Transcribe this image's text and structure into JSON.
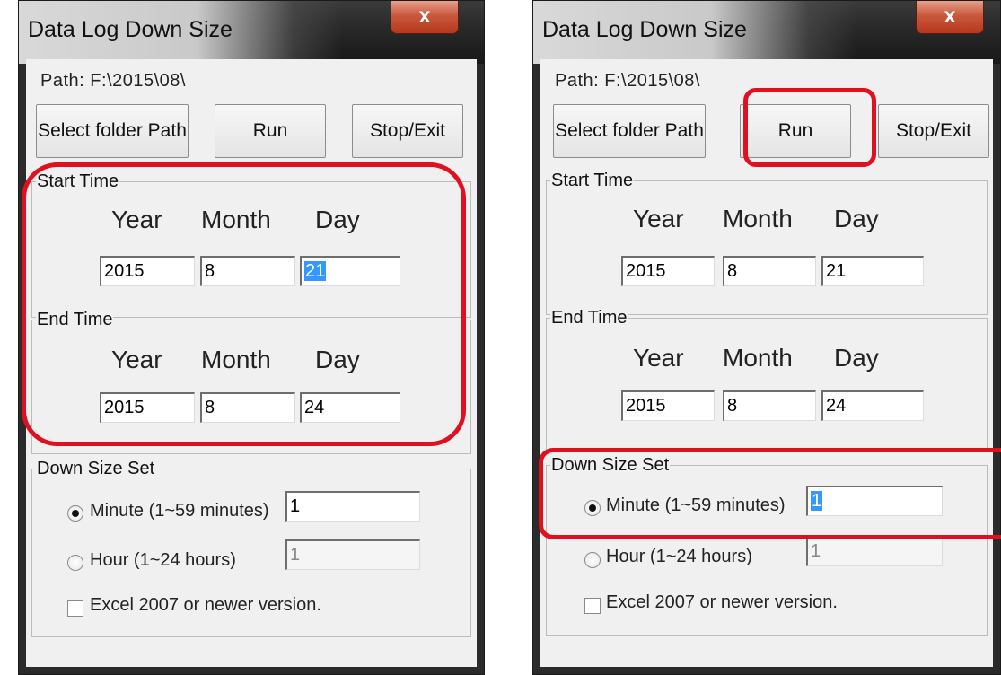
{
  "app": {
    "title": "Data Log Down Size",
    "close_glyph": "x"
  },
  "path_text": "Path:  F:\\2015\\08\\",
  "buttons": {
    "select": "Select folder Path",
    "run": "Run",
    "stop": "Stop/Exit"
  },
  "start_group": {
    "label": "Start Time"
  },
  "end_group": {
    "label": "End Time"
  },
  "headers": {
    "year": "Year",
    "month": "Month",
    "day": "Day"
  },
  "start": {
    "year": "2015",
    "month": "8",
    "day": "21"
  },
  "end": {
    "year": "2015",
    "month": "8",
    "day": "24"
  },
  "downsize": {
    "label": "Down Size Set",
    "minute_label": "Minute (1~59 minutes)",
    "minute_value": "1",
    "hour_label": "Hour (1~24 hours)",
    "hour_value": "1",
    "excel_label": "Excel 2007 or newer version.",
    "selected": "minute",
    "excel_checked": false
  },
  "icons": {
    "close": "close-icon",
    "radio": "radio-icon",
    "checkbox": "checkbox-icon"
  },
  "colors": {
    "highlight": "#e01020",
    "selection": "#3399ff",
    "close_button": "#c9583d"
  }
}
